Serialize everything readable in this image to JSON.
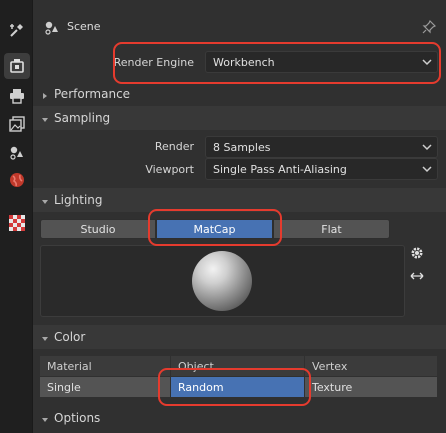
{
  "properties": {
    "title": "Scene",
    "render_engine": {
      "label": "Render Engine",
      "value": "Workbench"
    },
    "panels": {
      "performance": "Performance",
      "sampling": {
        "title": "Sampling",
        "render_label": "Render",
        "render_value": "8 Samples",
        "viewport_label": "Viewport",
        "viewport_value": "Single Pass Anti-Aliasing"
      },
      "lighting": {
        "title": "Lighting",
        "options": [
          "Studio",
          "MatCap",
          "Flat"
        ],
        "selected": "MatCap"
      },
      "color": {
        "title": "Color",
        "header": [
          "Material",
          "Object",
          "Vertex"
        ],
        "values": [
          "Single",
          "Random",
          "Texture"
        ],
        "selected": "Random"
      },
      "options": "Options"
    },
    "tabs": [
      "tool",
      "render",
      "output",
      "view-layer",
      "scene",
      "world",
      "texture"
    ],
    "active_tab": "render",
    "accent_color": "#4772b3",
    "callout_color": "#e53b2e"
  }
}
